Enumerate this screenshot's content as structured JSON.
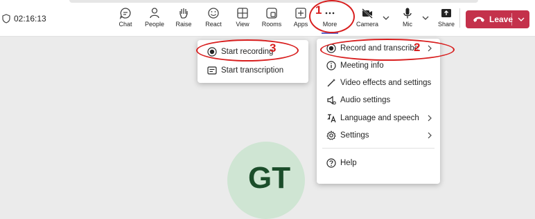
{
  "timer": "02:16:13",
  "toolbar": [
    {
      "label": "Chat",
      "icon": "chat-icon"
    },
    {
      "label": "People",
      "icon": "people-icon"
    },
    {
      "label": "Raise",
      "icon": "raise-hand-icon"
    },
    {
      "label": "React",
      "icon": "react-icon"
    },
    {
      "label": "View",
      "icon": "view-icon"
    },
    {
      "label": "Rooms",
      "icon": "rooms-icon"
    },
    {
      "label": "Apps",
      "icon": "apps-icon"
    },
    {
      "label": "More",
      "icon": "more-icon"
    },
    {
      "label": "Camera",
      "icon": "camera-off-icon"
    },
    {
      "label": "Mic",
      "icon": "mic-icon"
    },
    {
      "label": "Share",
      "icon": "share-icon"
    }
  ],
  "leave_label": "Leave",
  "main_menu": [
    {
      "label": "Record and transcribe",
      "icon": "record-icon",
      "submenu": true
    },
    {
      "label": "Meeting info",
      "icon": "info-icon",
      "submenu": false
    },
    {
      "label": "Video effects and settings",
      "icon": "video-effects-icon",
      "submenu": false
    },
    {
      "label": "Audio settings",
      "icon": "audio-settings-icon",
      "submenu": false
    },
    {
      "label": "Language and speech",
      "icon": "language-icon",
      "submenu": true
    },
    {
      "label": "Settings",
      "icon": "gear-icon",
      "submenu": true
    },
    {
      "label": "Help",
      "icon": "help-icon",
      "submenu": false
    }
  ],
  "sub_menu": [
    {
      "label": "Start recording",
      "icon": "record-icon"
    },
    {
      "label": "Start transcription",
      "icon": "transcription-icon"
    }
  ],
  "avatar_initials": "GT",
  "annotations": [
    "1",
    "2",
    "3"
  ],
  "colors": {
    "leave": "#c4314b",
    "accent": "#5b5fc7",
    "annotation": "#d81e1e",
    "avatar_bg": "#cfe5d3"
  }
}
